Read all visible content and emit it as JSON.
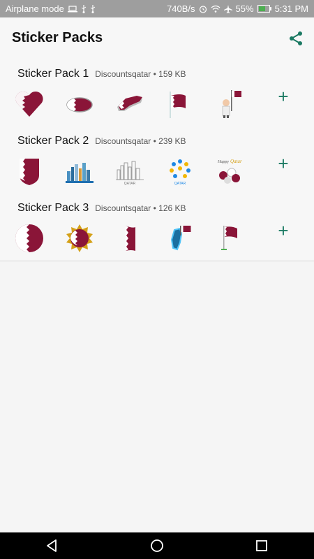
{
  "status_bar": {
    "mode": "Airplane mode",
    "speed": "740B/s",
    "battery": "55%",
    "time": "5:31 PM"
  },
  "header": {
    "title": "Sticker Packs",
    "share_icon": "share-icon"
  },
  "packs": [
    {
      "name": "Sticker Pack 1",
      "meta": "Discountsqatar • 159 KB",
      "add_label": "+"
    },
    {
      "name": "Sticker Pack 2",
      "meta": "Discountsqatar • 239 KB",
      "add_label": "+"
    },
    {
      "name": "Sticker Pack 3",
      "meta": "Discountsqatar • 126 KB",
      "add_label": "+"
    }
  ],
  "colors": {
    "accent": "#1b7a63",
    "maroon": "#8a1538"
  }
}
